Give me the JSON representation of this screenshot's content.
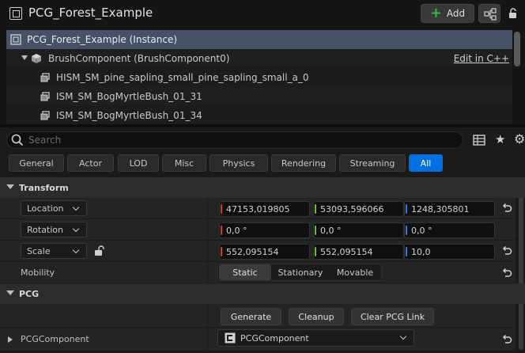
{
  "window": {
    "title": "PCG_Forest_Example",
    "add_label": "Add"
  },
  "tree": {
    "instance_label": "PCG_Forest_Example (Instance)",
    "brush_label": "BrushComponent (BrushComponent0)",
    "edit_link": "Edit in C++",
    "items": [
      "HISM_SM_pine_sapling_small_pine_sapling_small_a_0",
      "ISM_SM_BogMyrtleBush_01_31",
      "ISM_SM_BogMyrtleBush_01_34"
    ]
  },
  "search": {
    "placeholder": "Search"
  },
  "filters": [
    "General",
    "Actor",
    "LOD",
    "Misc",
    "Physics",
    "Rendering",
    "Streaming",
    "All"
  ],
  "active_filter": "All",
  "transform": {
    "header": "Transform",
    "location": {
      "label": "Location",
      "x": "47153,019805",
      "y": "53093,596066",
      "z": "1248,305801"
    },
    "rotation": {
      "label": "Rotation",
      "x": "0,0 °",
      "y": "0,0 °",
      "z": "0,0 °"
    },
    "scale": {
      "label": "Scale",
      "x": "552,095154",
      "y": "552,095154",
      "z": "10,0"
    },
    "mobility": {
      "label": "Mobility",
      "options": [
        "Static",
        "Stationary",
        "Movable"
      ],
      "selected": "Static"
    }
  },
  "pcg": {
    "header": "PCG",
    "generate_label": "Generate",
    "cleanup_label": "Cleanup",
    "clear_link_label": "Clear PCG Link",
    "component_label": "PCGComponent",
    "component_value": "PCGComponent"
  },
  "colors": {
    "accent": "#0070e0",
    "selected_row": "#455266",
    "axis_x": "#d83636",
    "axis_y": "#6fbf29",
    "axis_z": "#2d7bdc",
    "add_plus": "#38b24b"
  },
  "icons": [
    "actor-icon",
    "blueprint-icon",
    "lock-icon",
    "cube-icon",
    "static-mesh-icon",
    "search-icon",
    "table-icon",
    "star-icon",
    "gear-icon",
    "reset-arrow-icon",
    "pcg-icon"
  ]
}
